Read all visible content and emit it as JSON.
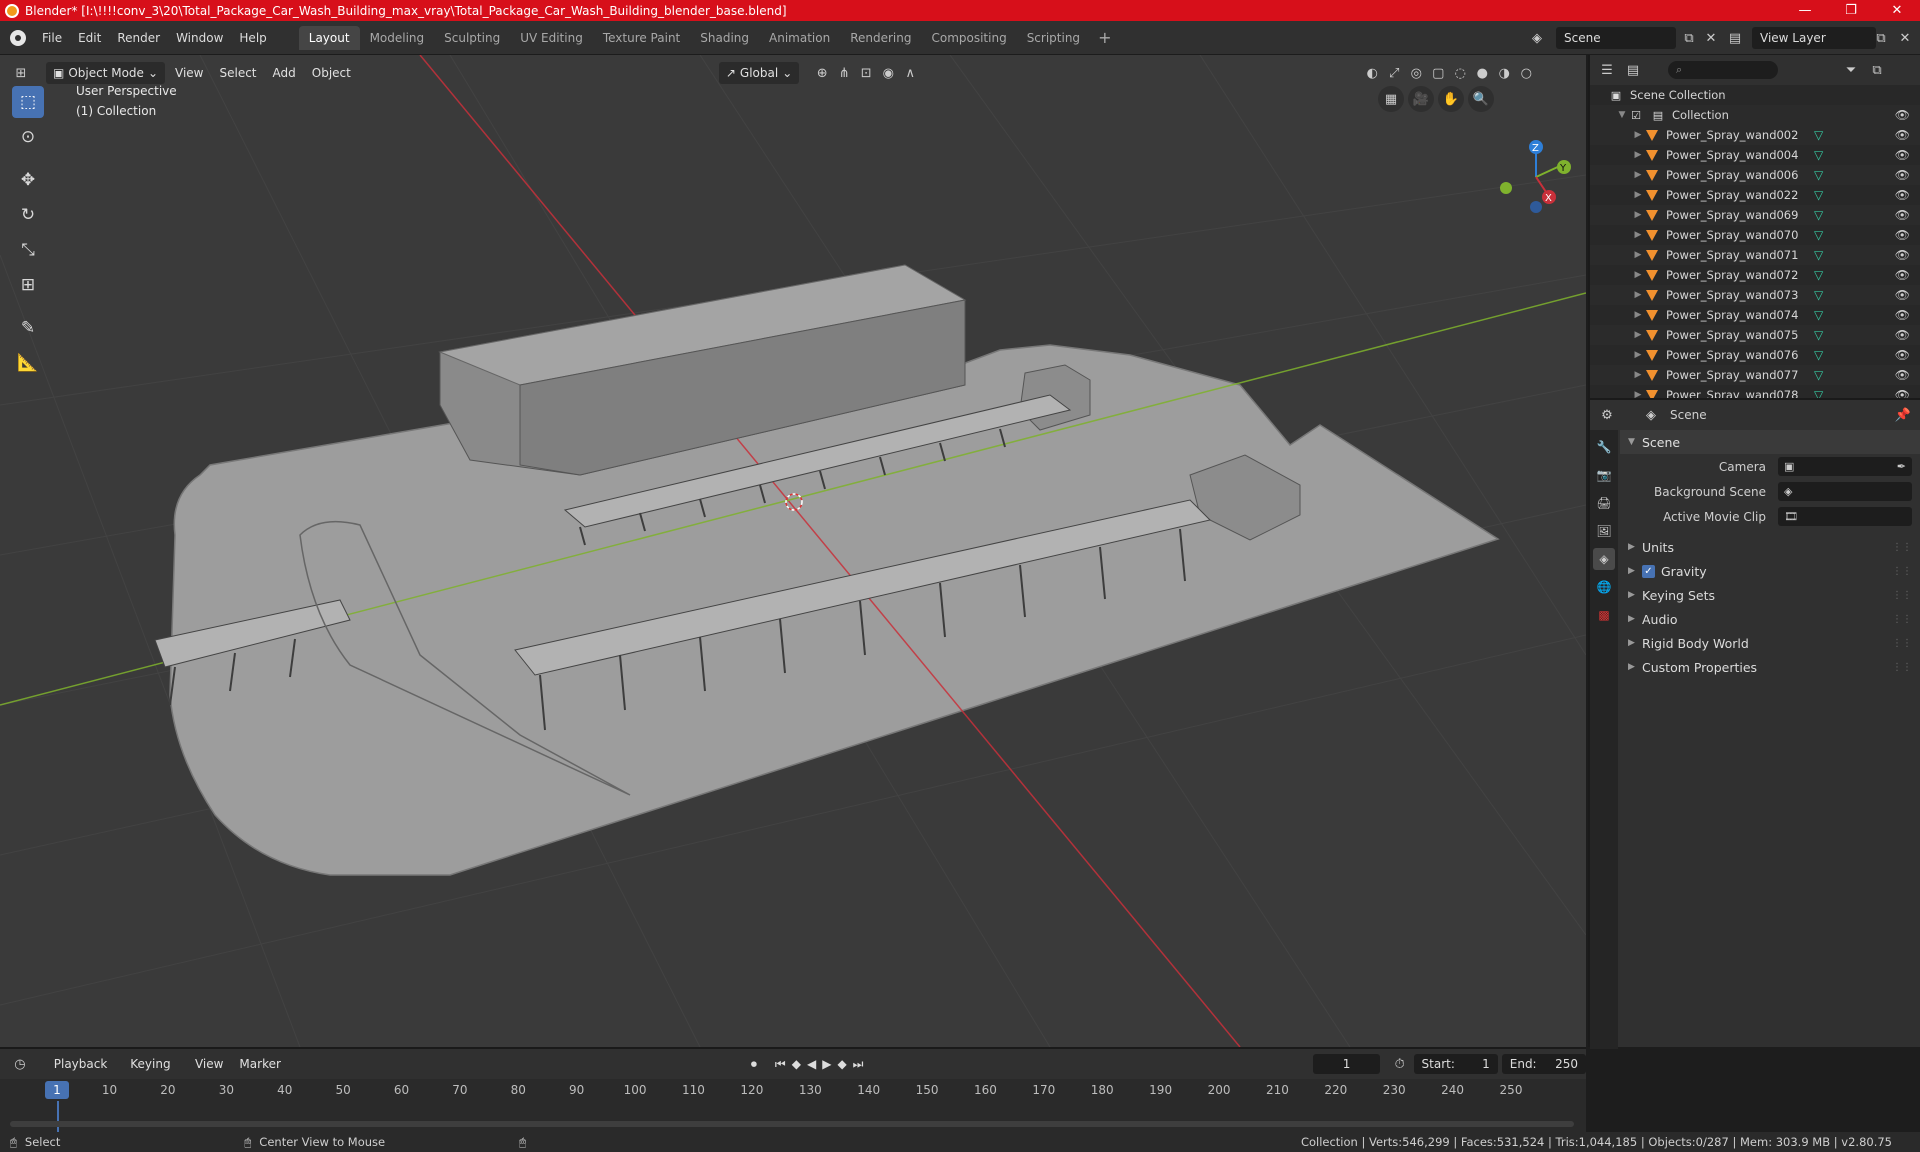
{
  "window": {
    "title": "Blender* [I:\\!!!!conv_3\\20\\Total_Package_Car_Wash_Building_max_vray\\Total_Package_Car_Wash_Building_blender_base.blend]",
    "controls": [
      "—",
      "❐",
      "✕"
    ]
  },
  "topbar": {
    "menus": [
      "File",
      "Edit",
      "Render",
      "Window",
      "Help"
    ],
    "workspaces": [
      "Layout",
      "Modeling",
      "Sculpting",
      "UV Editing",
      "Texture Paint",
      "Shading",
      "Animation",
      "Rendering",
      "Compositing",
      "Scripting"
    ],
    "active_workspace": "Layout",
    "scene": "Scene",
    "view_layer": "View Layer"
  },
  "viewport_header": {
    "mode": "Object Mode",
    "menus": [
      "View",
      "Select",
      "Add",
      "Object"
    ],
    "transform_orientation": "Global"
  },
  "viewport": {
    "perspective_label": "User Perspective",
    "collection_label": "(1) Collection",
    "axis_labels": {
      "x": "X",
      "y": "Y",
      "z": "Z"
    }
  },
  "outliner": {
    "root": "Scene Collection",
    "collection": "Collection",
    "items": [
      "Power_Spray_wand002",
      "Power_Spray_wand004",
      "Power_Spray_wand006",
      "Power_Spray_wand022",
      "Power_Spray_wand069",
      "Power_Spray_wand070",
      "Power_Spray_wand071",
      "Power_Spray_wand072",
      "Power_Spray_wand073",
      "Power_Spray_wand074",
      "Power_Spray_wand075",
      "Power_Spray_wand076",
      "Power_Spray_wand077",
      "Power_Spray_wand078"
    ]
  },
  "properties": {
    "header": "Scene",
    "panel_title": "Scene",
    "fields": [
      {
        "label": "Camera",
        "value": ""
      },
      {
        "label": "Background Scene",
        "value": ""
      },
      {
        "label": "Active Movie Clip",
        "value": ""
      }
    ],
    "sections": [
      "Units",
      "Gravity",
      "Keying Sets",
      "Audio",
      "Rigid Body World",
      "Custom Properties"
    ],
    "gravity_checked": true
  },
  "timeline": {
    "menus": [
      "Playback",
      "Keying",
      "View",
      "Marker"
    ],
    "current_frame": "1",
    "start_label": "Start:",
    "start": "1",
    "end_label": "End:",
    "end": "250",
    "ticks": [
      "10",
      "20",
      "30",
      "40",
      "50",
      "60",
      "70",
      "80",
      "90",
      "100",
      "110",
      "120",
      "130",
      "140",
      "150",
      "160",
      "170",
      "180",
      "190",
      "200",
      "210",
      "220",
      "230",
      "240",
      "250"
    ],
    "playhead": "1"
  },
  "statusbar": {
    "select": "Select",
    "center_view": "Center View to Mouse",
    "stats": "Collection | Verts:546,299 | Faces:531,524 | Tris:1,044,185 | Objects:0/287 | Mem: 303.9 MB | v2.80.75"
  },
  "colors": {
    "title_bar": "#d70f1a",
    "accent": "#4772b3",
    "x_axis": "#c8303a",
    "y_axis": "#7fb22d",
    "z_axis": "#2e7fd8",
    "mesh_icon": "#35c9a1",
    "object_icon": "#f2912f"
  }
}
